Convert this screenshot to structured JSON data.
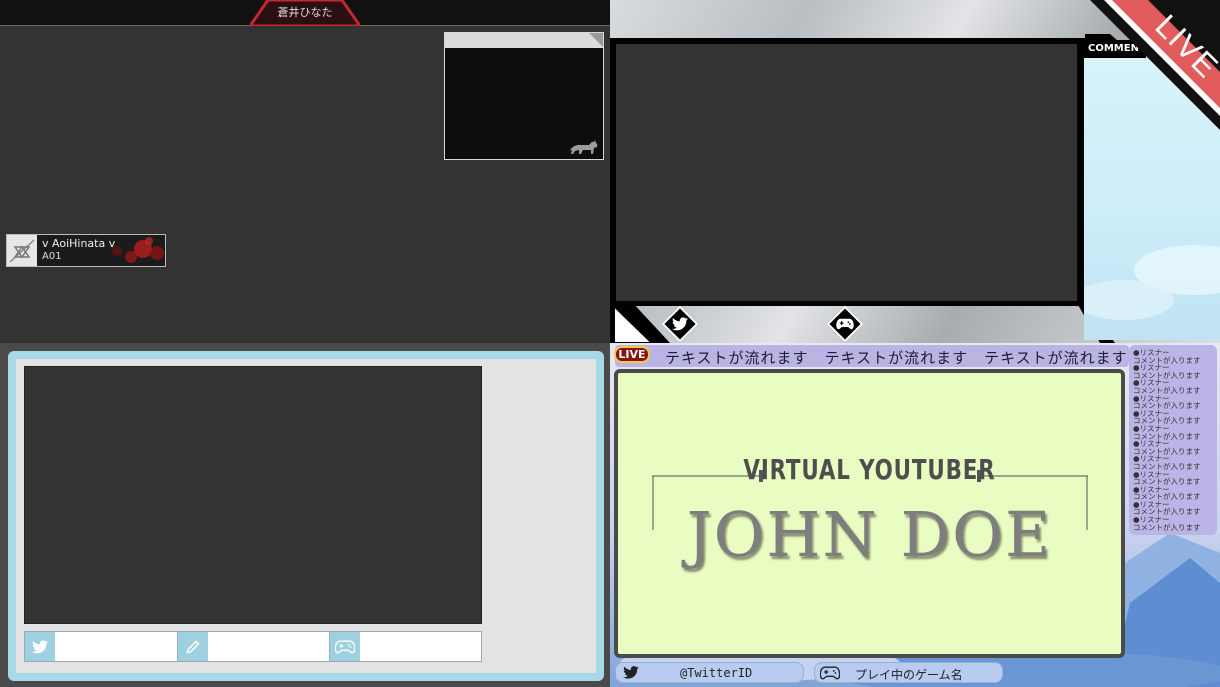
{
  "q1": {
    "tab_text": "蒼井ひなた",
    "name_badge": {
      "name": "v AoiHinata v",
      "sub": "A01"
    }
  },
  "q2": {
    "comment_header": "COMMENT",
    "live_label": "LIVE"
  },
  "q4": {
    "live_label": "LIVE",
    "ticker": "テキストが流れます　テキストが流れます　テキストが流れます",
    "subtitle": "VIRTUAL YOUTUBER",
    "title": "JOHN DOE",
    "comments": [
      "●リスナー",
      "コメントが入ります",
      "●リスナー",
      "コメントが入ります",
      "●リスナー",
      "コメントが入ります",
      "●リスナー",
      "コメントが入ります",
      "●リスナー",
      "コメントが入ります",
      "●リスナー",
      "コメントが入ります",
      "●リスナー",
      "コメントが入ります",
      "●リスナー",
      "コメントが入ります",
      "●リスナー",
      "コメントが入ります",
      "●リスナー",
      "コメントが入ります",
      "●リスナー",
      "コメントが入ります",
      "●リスナー",
      "コメントが入ります"
    ],
    "twitter_id": "@TwitterID",
    "game_name": "プレイ中のゲーム名"
  },
  "colors": {
    "live_red": "#e05a5a",
    "q3_frame": "#a9d9e6",
    "q4_panel": "#e9fcc1",
    "q4_lilac": "#bab5e6"
  },
  "icons": [
    "twitter-icon",
    "gamepad-icon",
    "pencil-icon",
    "cat-icon"
  ]
}
